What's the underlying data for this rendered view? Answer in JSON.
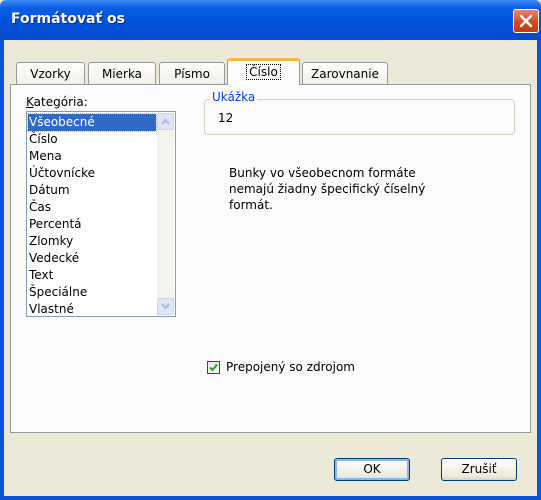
{
  "window": {
    "title": "Formátovať os",
    "close_icon": "close-icon"
  },
  "tabs": [
    {
      "label": "Vzorky"
    },
    {
      "label": "Mierka"
    },
    {
      "label": "Písmo"
    },
    {
      "label": "Číslo",
      "active": true
    },
    {
      "label": "Zarovnanie"
    }
  ],
  "category": {
    "label_underlined": "K",
    "label_rest": "ategória:",
    "items": [
      "Všeobecné",
      "Číslo",
      "Mena",
      "Účtovnícke",
      "Dátum",
      "Čas",
      "Percentá",
      "Zlomky",
      "Vedecké",
      "Text",
      "Špeciálne",
      "Vlastné"
    ],
    "selected": "Všeobecné"
  },
  "sample": {
    "legend": "Ukážka",
    "value": "12"
  },
  "description": {
    "lines": [
      "Bunky vo všeobecnom formáte",
      "nemajú žiadny špecifický číselný",
      "formát."
    ]
  },
  "linked_checkbox": {
    "label": "Prepojený so zdrojom",
    "checked": true
  },
  "buttons": {
    "ok": "OK",
    "cancel": "Zrušiť"
  },
  "colors": {
    "selection": "#316ac5",
    "title_bar": "#0052dd",
    "tab_highlight": "#f7b64a"
  }
}
